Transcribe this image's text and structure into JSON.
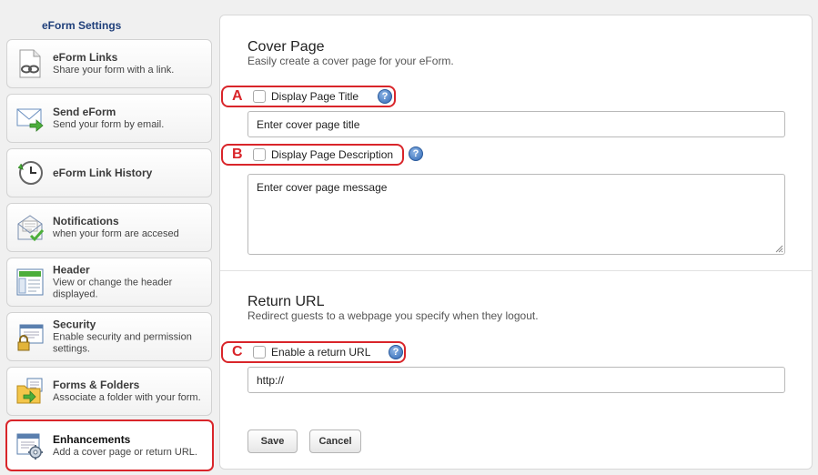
{
  "sidebar": {
    "title": "eForm Settings",
    "items": [
      {
        "label": "eForm Links",
        "description": "Share your form with a link.",
        "icon": "link-document-icon"
      },
      {
        "label": "Send eForm",
        "description": "Send your form by email.",
        "icon": "envelope-send-icon"
      },
      {
        "label": "eForm Link History",
        "description": "",
        "icon": "clock-history-icon"
      },
      {
        "label": "Notifications",
        "description": "when your form are accesed",
        "icon": "notification-mail-icon"
      },
      {
        "label": "Header",
        "description": "View or change the header displayed.",
        "icon": "header-layout-icon"
      },
      {
        "label": "Security",
        "description": "Enable security and permission settings.",
        "icon": "lock-window-icon"
      },
      {
        "label": "Forms & Folders",
        "description": "Associate a folder with your form.",
        "icon": "folder-icon"
      },
      {
        "label": "Enhancements",
        "description": "Add a cover page or return URL.",
        "icon": "window-gear-icon",
        "active": true
      }
    ]
  },
  "cover_page": {
    "title": "Cover Page",
    "subtitle": "Easily create a cover page for your eForm.",
    "options": [
      {
        "letter": "A",
        "label": "Display Page Title"
      },
      {
        "letter": "B",
        "label": "Display Page Description"
      }
    ],
    "title_input_value": "Enter cover page title",
    "message_value": "Enter cover page message"
  },
  "return_url": {
    "title": "Return URL",
    "subtitle": "Redirect guests to a webpage you specify when they logout.",
    "option": {
      "letter": "C",
      "label": "Enable a return URL"
    },
    "url_value": "http://"
  },
  "help_glyph": "?",
  "buttons": {
    "save": "Save",
    "cancel": "Cancel"
  },
  "colors": {
    "highlight": "#d9252a",
    "sidebar_title": "#1f3f7a",
    "help_icon": "#2f68b5"
  }
}
